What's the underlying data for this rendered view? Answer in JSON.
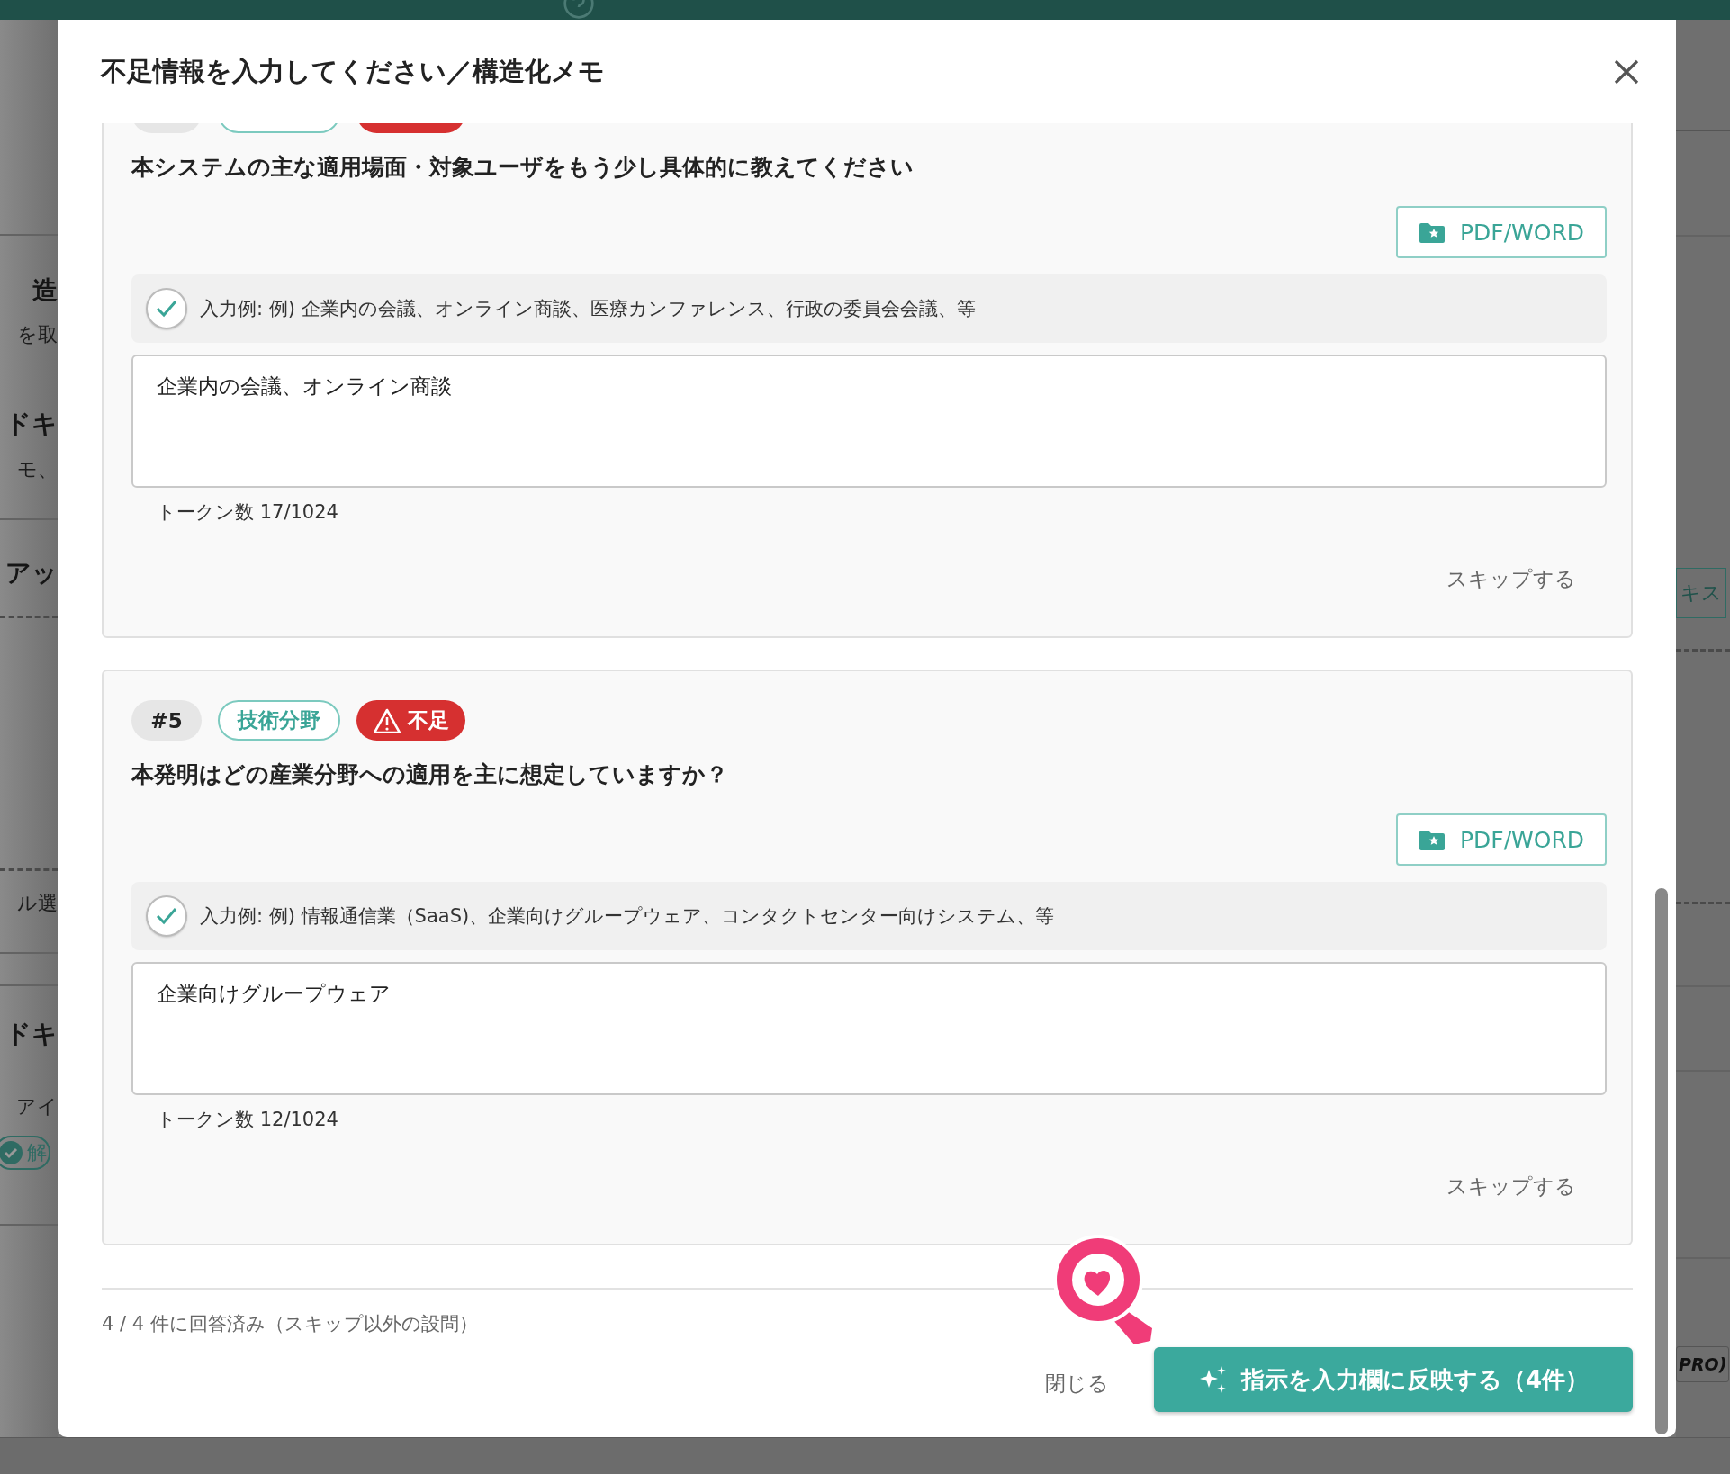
{
  "background": {
    "left": [
      {
        "kind": "rule"
      },
      {
        "kind": "heading",
        "text": "造"
      },
      {
        "kind": "text",
        "text": "を取"
      },
      {
        "kind": "heading",
        "text": "ドキ"
      },
      {
        "kind": "text",
        "text": "モ、"
      },
      {
        "kind": "rule"
      },
      {
        "kind": "heading",
        "text": "アッ"
      },
      {
        "kind": "dashed"
      },
      {
        "kind": "dashed"
      },
      {
        "kind": "text",
        "text": "ル選"
      },
      {
        "kind": "rule"
      },
      {
        "kind": "rule"
      },
      {
        "kind": "heading",
        "text": "ドキ"
      },
      {
        "kind": "text",
        "text": "アイ"
      },
      {
        "kind": "badge",
        "text": "解"
      },
      {
        "kind": "rule"
      }
    ],
    "right": [
      {
        "kind": "rule"
      },
      {
        "kind": "rule"
      },
      {
        "kind": "outline",
        "text": "キス"
      },
      {
        "kind": "dashed"
      },
      {
        "kind": "dashed"
      },
      {
        "kind": "rule"
      },
      {
        "kind": "rule"
      },
      {
        "kind": "rule"
      },
      {
        "kind": "outline",
        "text": "PRO)"
      }
    ]
  },
  "dialog": {
    "title": "不足情報を入力してください／構造化メモ",
    "questions": [
      {
        "badges": [
          {
            "kind": "number"
          },
          {
            "kind": "category"
          },
          {
            "kind": "status"
          }
        ],
        "question": "本システムの主な適用場面・対象ユーザをもう少し具体的に教えてください",
        "button_label": "PDF/WORD",
        "hint_checked": true,
        "hint": "入力例: 例) 企業内の会議、オンライン商談、医療カンファレンス、行政の委員会会議、等",
        "value": "企業内の会議、オンライン商談",
        "token_count": "トークン数 17/1024",
        "skip_label": "スキップする"
      },
      {
        "badges": [
          {
            "kind": "number",
            "text": "#5"
          },
          {
            "kind": "category",
            "text": "技術分野"
          },
          {
            "kind": "status",
            "text": "不足"
          }
        ],
        "question": "本発明はどの産業分野への適用を主に想定していますか？",
        "button_label": "PDF/WORD",
        "hint_checked": true,
        "hint": "入力例: 例) 情報通信業（SaaS)、企業向けグループウェア、コンタクトセンター向けシステム、等",
        "value": "企業向けグループウェア",
        "token_count": "トークン数 12/1024",
        "skip_label": "スキップする"
      }
    ],
    "progress": "4 / 4 件に回答済み（スキップ以外の設問）",
    "close_label": "閉じる",
    "submit_label": "指示を入力欄に反映する（4件）"
  }
}
